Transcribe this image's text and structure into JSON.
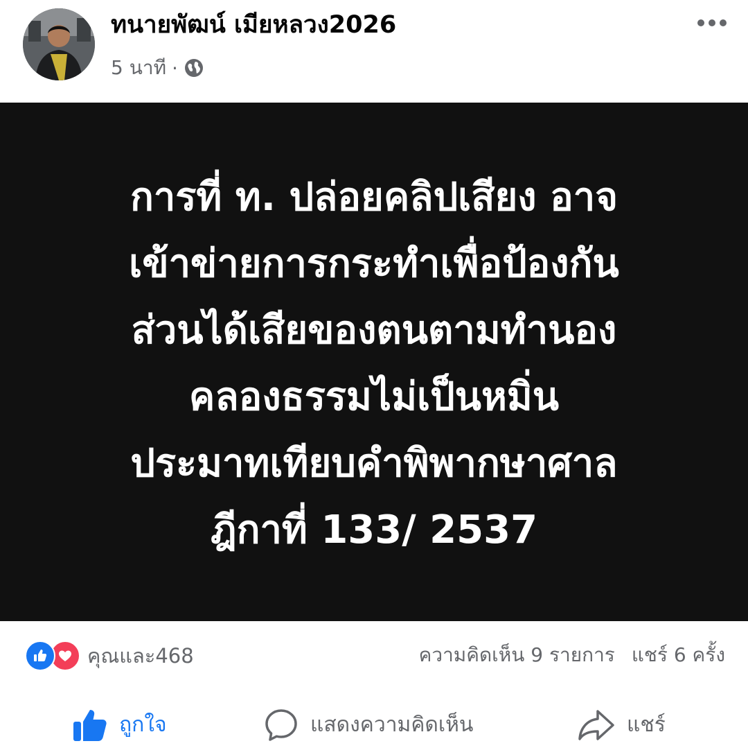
{
  "post": {
    "author": "ทนายพัฒน์ เมียหลวง2026",
    "time": "5 นาที",
    "separator": "·",
    "privacy_icon": "globe-icon",
    "more_icon": "more-horizontal-icon"
  },
  "image_text": {
    "lines": [
      "การที่ ท. ปล่อยคลิปเสียง อาจ",
      "เข้าข่ายการกระทำเพื่อป้องกัน",
      "ส่วนได้เสียของตนตามทำนอง",
      "คลองธรรมไม่เป็นหมิ่น",
      "ประมาทเทียบคำพิพากษาศาล",
      "ฎีกาที่ 133/ 2537"
    ]
  },
  "stats": {
    "reaction_icons": [
      "like-icon",
      "love-icon"
    ],
    "reactions": "คุณและ468",
    "comments": "ความคิดเห็น 9 รายการ",
    "shares": "แชร์ 6 ครั้ง"
  },
  "actions": {
    "like": "ถูกใจ",
    "comment": "แสดงความคิดเห็น",
    "share": "แชร์"
  },
  "colors": {
    "accent": "#1877f2",
    "love": "#f33e58",
    "secondary_text": "#65676b",
    "image_background": "#111111"
  }
}
